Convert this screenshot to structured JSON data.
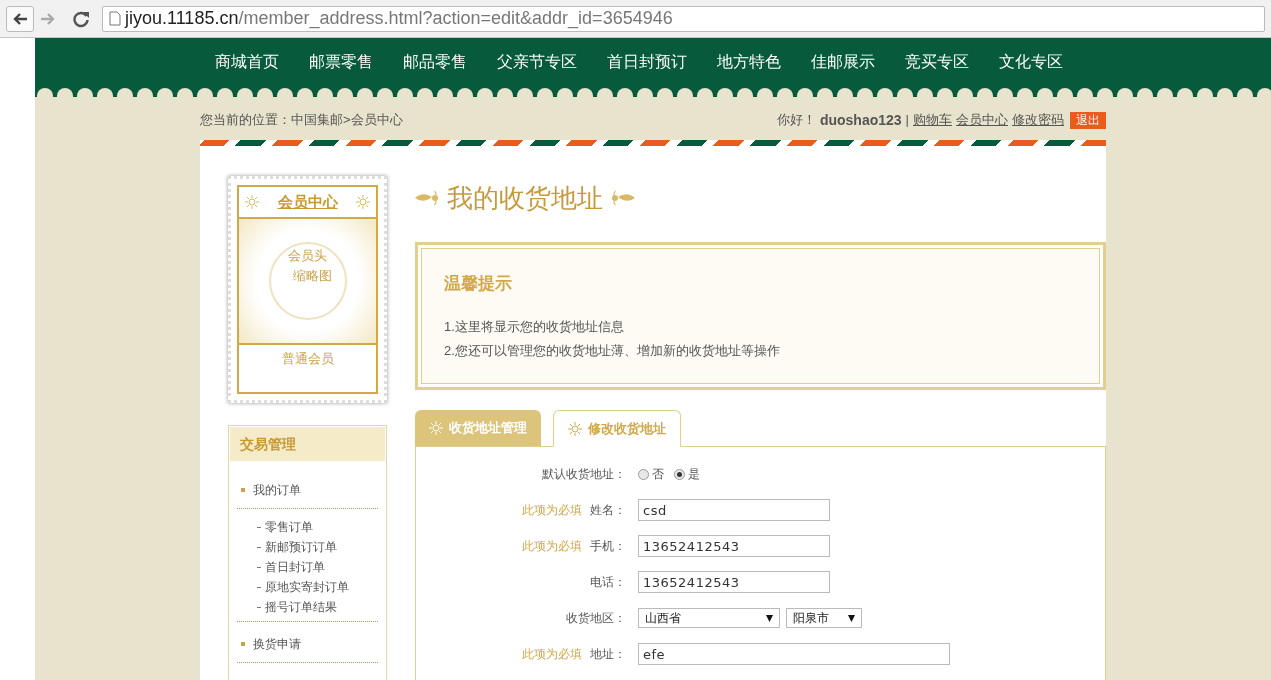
{
  "browser": {
    "url_host": "jiyou.11185.cn",
    "url_path": "/member_address.html?action=edit&addr_id=3654946"
  },
  "nav": [
    "商城首页",
    "邮票零售",
    "邮品零售",
    "父亲节专区",
    "首日封预订",
    "地方特色",
    "佳邮展示",
    "竞买专区",
    "文化专区"
  ],
  "breadcrumb": "您当前的位置：中国集邮>会员中心",
  "user_bar": {
    "greeting": "你好！",
    "username": "duoshao123",
    "separator": "|",
    "links": [
      "购物车",
      "会员中心",
      "修改密码"
    ],
    "logout": "退出"
  },
  "member_card": {
    "title": "会员中心",
    "avatar_alt_lines": [
      "会员头",
      "缩略图"
    ],
    "level": "普通会员"
  },
  "side_menu": {
    "title": "交易管理",
    "items": [
      {
        "label": "我的订单",
        "children": [
          {
            "label": "零售订单"
          },
          {
            "label": "新邮预订订单"
          },
          {
            "label": "首日封订单"
          },
          {
            "label": "原地实寄封订单"
          },
          {
            "label": "摇号订单结果"
          }
        ]
      },
      {
        "label": "换货申请"
      }
    ]
  },
  "page_title": "我的收货地址",
  "tip": {
    "title": "温馨提示",
    "lines": [
      "1.这里将显示您的收货地址信息",
      "2.您还可以管理您的收货地址薄、增加新的收货地址等操作"
    ]
  },
  "tabs": [
    {
      "label": "收货地址管理",
      "selected": false
    },
    {
      "label": "修改收货地址",
      "selected": true
    }
  ],
  "form": [
    {
      "kind": "radio",
      "label": "默认收货地址：",
      "options": [
        {
          "label": "否",
          "selected": false
        },
        {
          "label": "是",
          "selected": true
        }
      ]
    },
    {
      "kind": "text",
      "note": "此项为必填",
      "label": "姓名：",
      "value": "csd"
    },
    {
      "kind": "text",
      "note": "此项为必填",
      "label": "手机：",
      "value": "13652412543"
    },
    {
      "kind": "text",
      "label": "电话：",
      "value": "13652412543"
    },
    {
      "kind": "select",
      "label": "收货地区：",
      "selects": [
        "山西省",
        "阳泉市"
      ]
    },
    {
      "kind": "wide_text",
      "note": "此项为必填",
      "label": "地址：",
      "value": "efe"
    }
  ]
}
